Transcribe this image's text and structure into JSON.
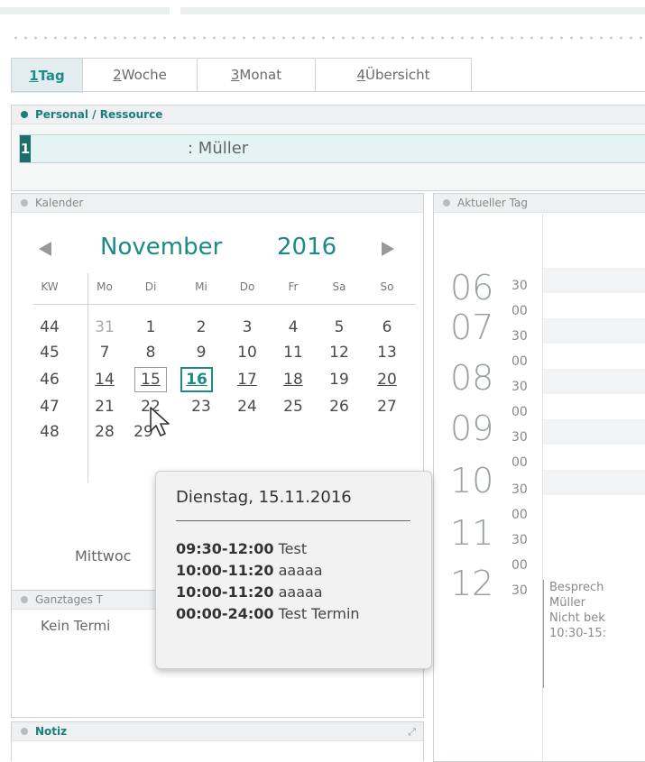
{
  "tabs": [
    {
      "key": "1",
      "label": " Tag",
      "active": true
    },
    {
      "key": "2",
      "label": " Woche",
      "active": false
    },
    {
      "key": "3",
      "label": " Monat",
      "active": false
    },
    {
      "key": "4",
      "label": " Übersicht",
      "active": false
    }
  ],
  "personal": {
    "title": "Personal / Ressource",
    "number": "1",
    "name": ": Müller"
  },
  "kalender": {
    "title": "Kalender",
    "month": "November",
    "year": "2016",
    "headers": [
      "KW",
      "Mo",
      "Di",
      "Mi",
      "Do",
      "Fr",
      "Sa",
      "So"
    ],
    "rows": [
      {
        "kw": "44",
        "days": [
          "31",
          "1",
          "2",
          "3",
          "4",
          "5",
          "6"
        ]
      },
      {
        "kw": "45",
        "days": [
          "7",
          "8",
          "9",
          "10",
          "11",
          "12",
          "13"
        ]
      },
      {
        "kw": "46",
        "days": [
          "14",
          "15",
          "16",
          "17",
          "18",
          "19",
          "20"
        ]
      },
      {
        "kw": "47",
        "days": [
          "21",
          "22",
          "23",
          "24",
          "25",
          "26",
          "27"
        ]
      },
      {
        "kw": "48",
        "days": [
          "28",
          "29"
        ]
      }
    ],
    "selected_label": "Mittwoc"
  },
  "ganztages": {
    "title": "Ganztages T",
    "empty_text": "Kein Termi"
  },
  "notiz": {
    "title": "Notiz"
  },
  "aktueller_tag": {
    "title": "Aktueller Tag",
    "hours": [
      "06",
      "07",
      "08",
      "09",
      "10",
      "11",
      "12"
    ],
    "appointment": [
      "Besprech",
      "Müller",
      "Nicht bek",
      "10:30-15:"
    ]
  },
  "tooltip": {
    "title": "Dienstag, 15.11.2016",
    "entries": [
      {
        "time": "09:30-12:00",
        "text": " Test"
      },
      {
        "time": "10:00-11:20",
        "text": " aaaaa"
      },
      {
        "time": "10:00-11:20",
        "text": " aaaaa"
      },
      {
        "time": "00:00-24:00",
        "text": " Test Termin"
      }
    ]
  },
  "colors": {
    "accent": "#1d8a86",
    "panel_header": "#eef0f1",
    "border": "#cfd3d4"
  }
}
